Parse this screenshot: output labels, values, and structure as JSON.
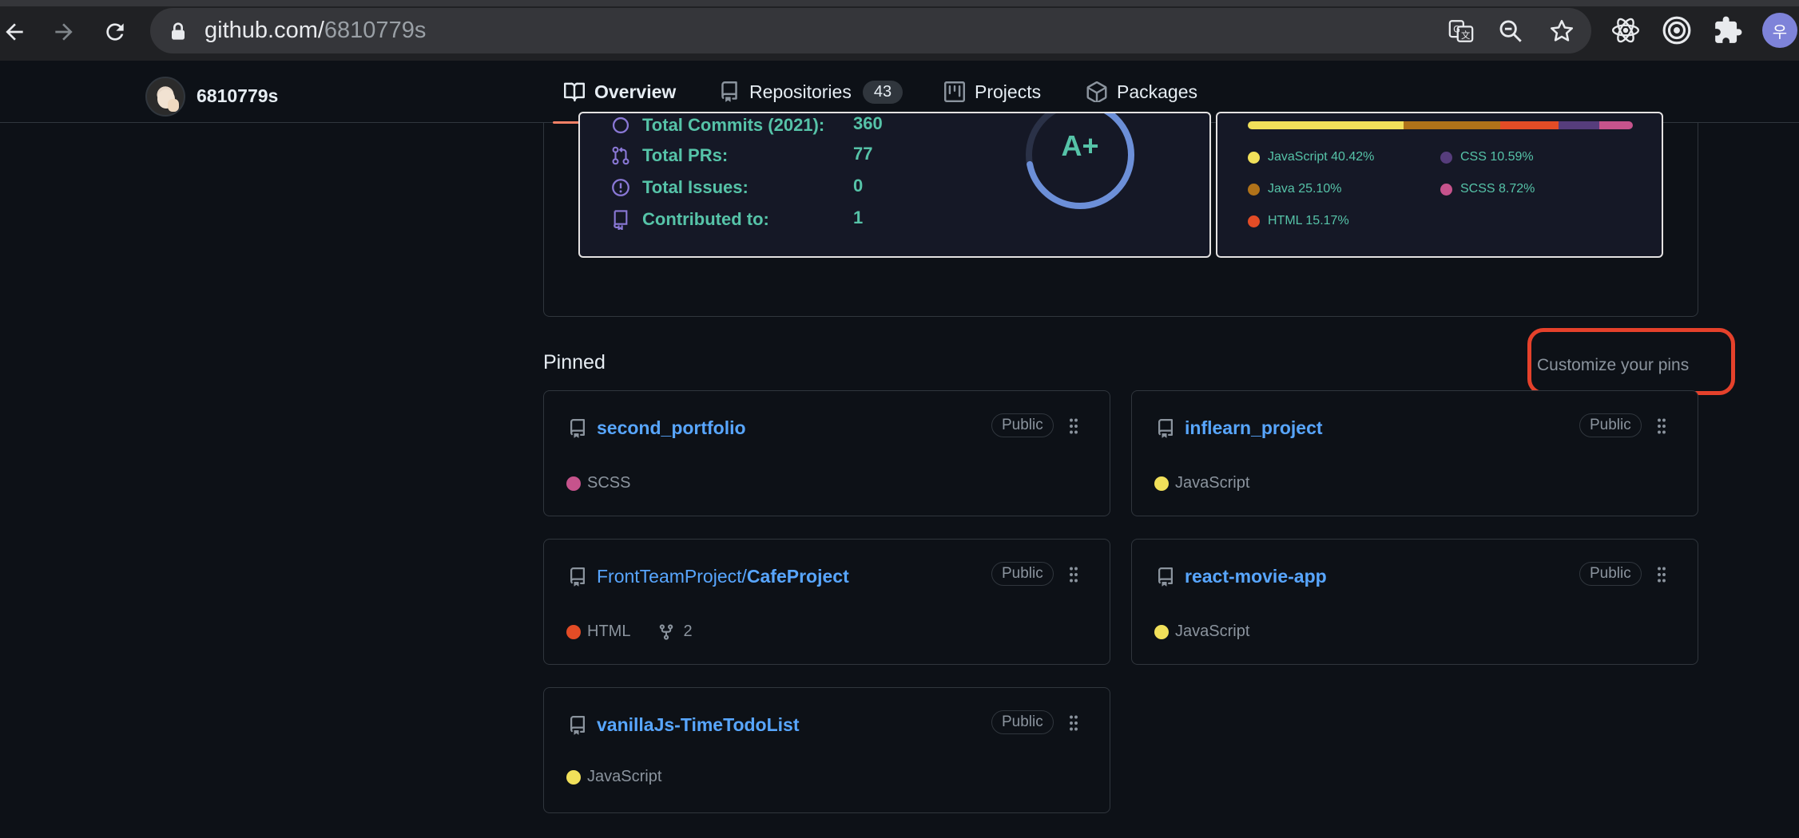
{
  "browser": {
    "url_host": "github.com/",
    "url_path": "6810779s",
    "profile_initial": "우"
  },
  "nav": {
    "username": "6810779s",
    "tabs": [
      {
        "label": "Overview",
        "icon": "book-icon",
        "active": true
      },
      {
        "label": "Repositories",
        "icon": "repo-icon",
        "count": "43"
      },
      {
        "label": "Projects",
        "icon": "project-icon"
      },
      {
        "label": "Packages",
        "icon": "package-icon"
      }
    ]
  },
  "stats": {
    "rows": [
      {
        "label": "Total Commits (2021):",
        "value": "360"
      },
      {
        "label": "Total PRs:",
        "value": "77"
      },
      {
        "label": "Total Issues:",
        "value": "0"
      },
      {
        "label": "Contributed to:",
        "value": "1"
      }
    ],
    "rank": "A+",
    "rank_progress": 0.72
  },
  "languages": {
    "items": [
      {
        "label": "JavaScript 40.42%",
        "color": "#f1e05a",
        "percent": 40.42
      },
      {
        "label": "Java 25.10%",
        "color": "#b07219",
        "percent": 25.1
      },
      {
        "label": "HTML 15.17%",
        "color": "#e34c26",
        "percent": 15.17
      },
      {
        "label": "CSS 10.59%",
        "color": "#563d7c",
        "percent": 10.59
      },
      {
        "label": "SCSS 8.72%",
        "color": "#c6538c",
        "percent": 8.72
      }
    ]
  },
  "pinned": {
    "title": "Pinned",
    "customize_label": "Customize your pins",
    "repos": [
      {
        "owner": "",
        "name": "second_portfolio",
        "visibility": "Public",
        "language": "SCSS",
        "lang_color": "#c6538c",
        "forks": ""
      },
      {
        "owner": "",
        "name": "inflearn_project",
        "visibility": "Public",
        "language": "JavaScript",
        "lang_color": "#f1e05a",
        "forks": ""
      },
      {
        "owner": "FrontTeamProject/",
        "name": "CafeProject",
        "visibility": "Public",
        "language": "HTML",
        "lang_color": "#e34c26",
        "forks": "2"
      },
      {
        "owner": "",
        "name": "react-movie-app",
        "visibility": "Public",
        "language": "JavaScript",
        "lang_color": "#f1e05a",
        "forks": ""
      },
      {
        "owner": "",
        "name": "vanillaJs-TimeTodoList",
        "visibility": "Public",
        "language": "JavaScript",
        "lang_color": "#f1e05a",
        "forks": ""
      }
    ]
  }
}
